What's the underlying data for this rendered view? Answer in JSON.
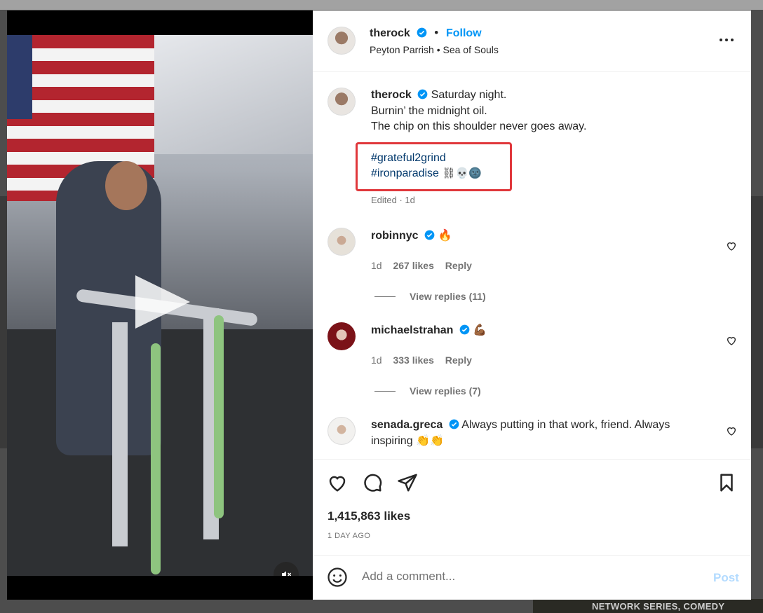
{
  "post": {
    "author": "therock",
    "follow_label": "Follow",
    "audio": "Peyton Parrish • Sea of Souls",
    "caption_lines": [
      "Saturday night.",
      "Burnin’ the midnight oil.",
      "The chip on this shoulder never goes away."
    ],
    "hashtag_1": "#grateful2grind",
    "hashtag_2": "#ironparadise",
    "hashtag_emojis": "⛓💀🌚",
    "edited": "Edited · 1d",
    "likes": "1,415,863 likes",
    "date": "1 DAY AGO"
  },
  "comments": [
    {
      "user": "robinnyc",
      "text": "🔥",
      "age": "1d",
      "likes": "267 likes",
      "reply": "Reply",
      "view_replies": "View replies (11)"
    },
    {
      "user": "michaelstrahan",
      "text": "💪🏾",
      "age": "1d",
      "likes": "333 likes",
      "reply": "Reply",
      "view_replies": "View replies (7)"
    },
    {
      "user": "senada.greca",
      "text": "Always putting in that work, friend. Always inspiring 👏👏"
    }
  ],
  "comment_box": {
    "placeholder": "Add a comment...",
    "post_label": "Post"
  },
  "background": {
    "banner": "NETWORK SERIES, COMEDY"
  },
  "colors": {
    "accent": "#0095f6",
    "highlight_box": "#e0373b",
    "hashtag": "#00376b"
  },
  "icons": [
    "more-icon",
    "verified-icon",
    "heart-icon",
    "comment-icon",
    "share-icon",
    "bookmark-icon",
    "emoji-icon",
    "mute-icon",
    "play-icon"
  ]
}
